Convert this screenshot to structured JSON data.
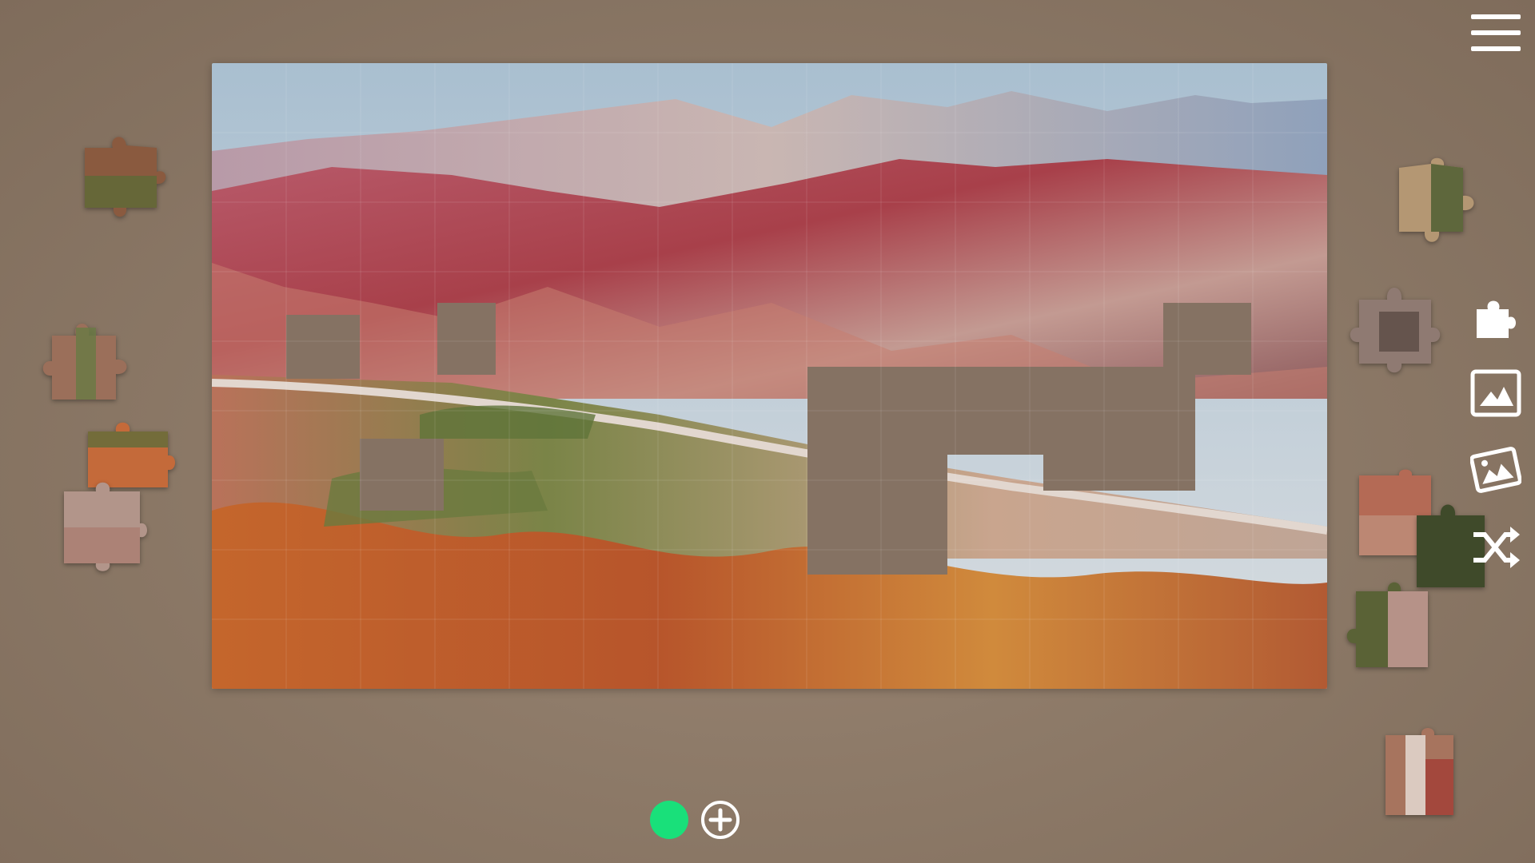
{
  "puzzle": {
    "image_description_hidden": "",
    "colors": {
      "background": "#8d7a68",
      "sky": "#b9cad8",
      "mountain_far": "#c4b0b3",
      "mountain_red": "#b24a4e",
      "valley_green": "#6f7d47",
      "hill_orange": "#c8682e",
      "missing_slot": "#857263"
    }
  },
  "toolbar": {
    "menu_icon": "hamburger-menu-icon",
    "pieces_icon": "puzzle-piece-icon",
    "preview_icon": "image-preview-icon",
    "background_icon": "background-image-icon",
    "shuffle_icon": "shuffle-icon"
  },
  "status": {
    "indicator_color": "#19e07a",
    "add_icon": "plus-circle-icon"
  }
}
